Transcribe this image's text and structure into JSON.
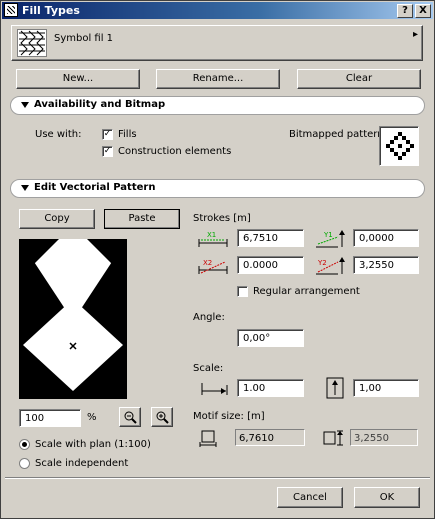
{
  "window": {
    "title": "Fill Types",
    "help": "?",
    "close": "X"
  },
  "fill_selector": {
    "name": "Symbol fil 1",
    "arrow": "▸"
  },
  "top_buttons": {
    "new": "New...",
    "rename": "Rename...",
    "clear": "Clear"
  },
  "availability": {
    "header": "Availability and Bitmap",
    "use_with": "Use with:",
    "fills": {
      "label": "Fills",
      "checked": true
    },
    "construction": {
      "label": "Construction elements",
      "checked": true
    },
    "bitmapped_pattern": "Bitmapped pattern:"
  },
  "vectorial": {
    "header": "Edit Vectorial Pattern",
    "copy": "Copy",
    "paste": "Paste",
    "strokes": "Strokes [m]",
    "x1": "6,7510",
    "y1": "0,0000",
    "x2": "0.0000",
    "y2": "3,2550",
    "x1_tag": "X1",
    "y1_tag": "Y1",
    "x2_tag": "X2",
    "y2_tag": "Y2",
    "regular_arrangement": {
      "label": "Regular arrangement",
      "checked": false
    },
    "angle_label": "Angle:",
    "angle_value": "0,00°",
    "scale_label": "Scale:",
    "scale_x": "1.00",
    "scale_y": "1,00",
    "motif_label": "Motif size: [m]",
    "motif_x": "6,7610",
    "motif_y": "3,2550",
    "zoom_value": "100",
    "zoom_unit": "%",
    "zoom_out": "−",
    "zoom_in": "+",
    "scale_with_plan": {
      "label": "Scale with plan (1:100)",
      "selected": true
    },
    "scale_independent": {
      "label": "Scale independent",
      "selected": false
    }
  },
  "bottom_buttons": {
    "cancel": "Cancel",
    "ok": "OK"
  },
  "icons": [
    "window-icon",
    "fill-swatch-icon",
    "bitmap-pattern-icon",
    "zoom-out-icon",
    "zoom-in-icon",
    "x1-stroke-icon",
    "y1-stroke-icon",
    "x2-stroke-icon",
    "y2-stroke-icon",
    "scale-x-icon",
    "scale-y-icon",
    "motif-x-icon",
    "motif-y-icon"
  ]
}
